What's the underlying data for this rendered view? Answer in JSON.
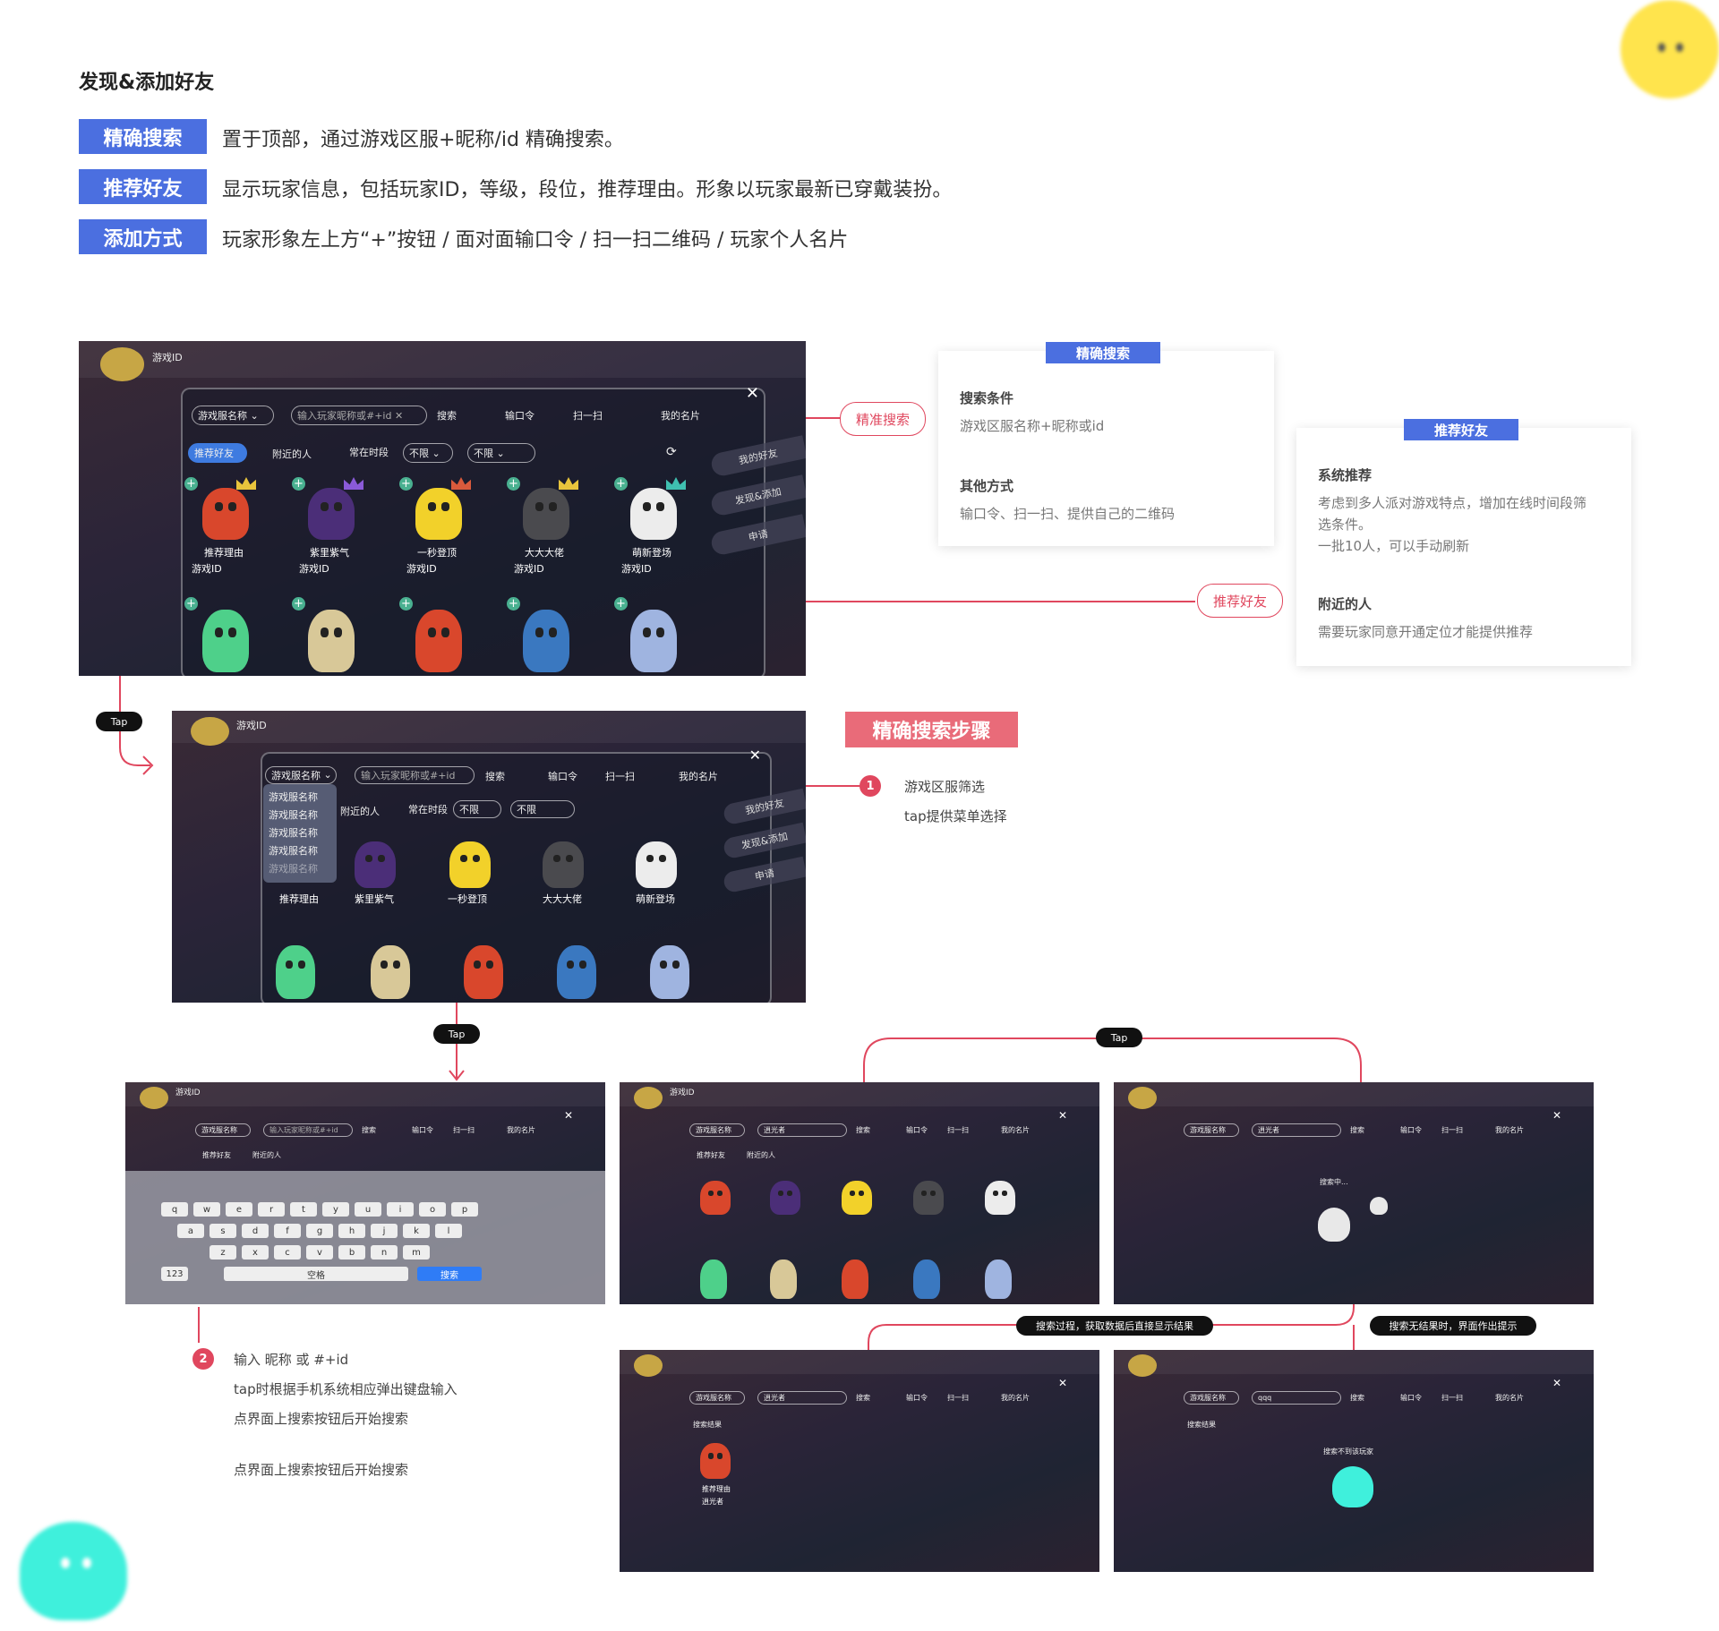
{
  "page_title": "发现&添加好友",
  "features": [
    {
      "tag": "精确搜索",
      "text": "置于顶部，通过游戏区服+昵称/id 精确搜索。"
    },
    {
      "tag": "推荐好友",
      "text": "显示玩家信息，包括玩家ID，等级，段位，推荐理由。形象以玩家最新已穿戴装扮。"
    },
    {
      "tag": "添加方式",
      "text": "玩家形象左上方“+”按钮 / 面对面输口令 / 扫一扫二维码 / 玩家个人名片"
    }
  ],
  "game_ui": {
    "player_id": "游戏ID",
    "server_select": "游戏服名称",
    "search_placeholder": "输入玩家昵称或#+id",
    "search_btn": "搜索",
    "code_btn": "输口令",
    "scan_btn": "扫一扫",
    "card_btn": "我的名片",
    "tab_recommend": "推荐好友",
    "tab_nearby": "附近的人",
    "active_time": "常在时段",
    "filter_any": "不限",
    "side_my_friends": "我的好友",
    "side_discover": "发现&添加",
    "side_apply": "申请",
    "char_names": [
      "推荐理由",
      "紫里紫气",
      "一秒登顶",
      "大大大佬",
      "萌新登场"
    ],
    "char_id": "游戏ID",
    "dropdown_items": [
      "游戏服名称",
      "游戏服名称",
      "游戏服名称",
      "游戏服名称",
      "游戏服名称"
    ],
    "keyboard_row1": [
      "q",
      "w",
      "e",
      "r",
      "t",
      "y",
      "u",
      "i",
      "o",
      "p"
    ],
    "keyboard_row2": [
      "a",
      "s",
      "d",
      "f",
      "g",
      "h",
      "j",
      "k",
      "l"
    ],
    "keyboard_row3": [
      "z",
      "x",
      "c",
      "v",
      "b",
      "n",
      "m"
    ],
    "keyboard_space": "空格",
    "keyboard_search": "搜索",
    "keyboard_num": "123",
    "searching": "搜索中...",
    "search_result": "搜索结果",
    "no_result": "搜索不到该玩家",
    "typed_name": "逍光者"
  },
  "card_precise": {
    "header": "精确搜索",
    "s1_title": "搜索条件",
    "s1_text": "游戏区服名称+昵称或id",
    "s2_title": "其他方式",
    "s2_text": "输口令、扫一扫、提供自己的二维码"
  },
  "card_recommend": {
    "header": "推荐好友",
    "s1_title": "系统推荐",
    "s1_lines": [
      "考虑到多人派对游戏特点，增加在线时间段筛",
      "选条件。",
      "一批10人，可以手动刷新"
    ],
    "s2_title": "附近的人",
    "s2_text": "需要玩家同意开通定位才能提供推荐"
  },
  "callouts": {
    "precise": "精准搜索",
    "recommend": "推荐好友"
  },
  "step_banner": "精确搜索步骤",
  "tap": "Tap",
  "step1": {
    "num": "1",
    "lines": [
      "游戏区服筛选",
      "tap提供菜单选择"
    ]
  },
  "step2": {
    "num": "2",
    "lines": [
      "输入 昵称 或 #+id",
      "tap时根据手机系统相应弹出键盘输入",
      "点界面上搜索按钮后开始搜索",
      "点界面上搜索按钮后开始搜索"
    ]
  },
  "flow_labels": {
    "searching": "搜索过程，获取数据后直接显示结果",
    "no_result": "搜索无结果时，界面作出提示"
  },
  "colors": {
    "accent_blue": "#4b6fe0",
    "accent_red": "#e0475e",
    "step_pink": "#e96b79",
    "mascot_yellow": "#ffe44d",
    "mascot_cyan": "#3ff0dc"
  }
}
